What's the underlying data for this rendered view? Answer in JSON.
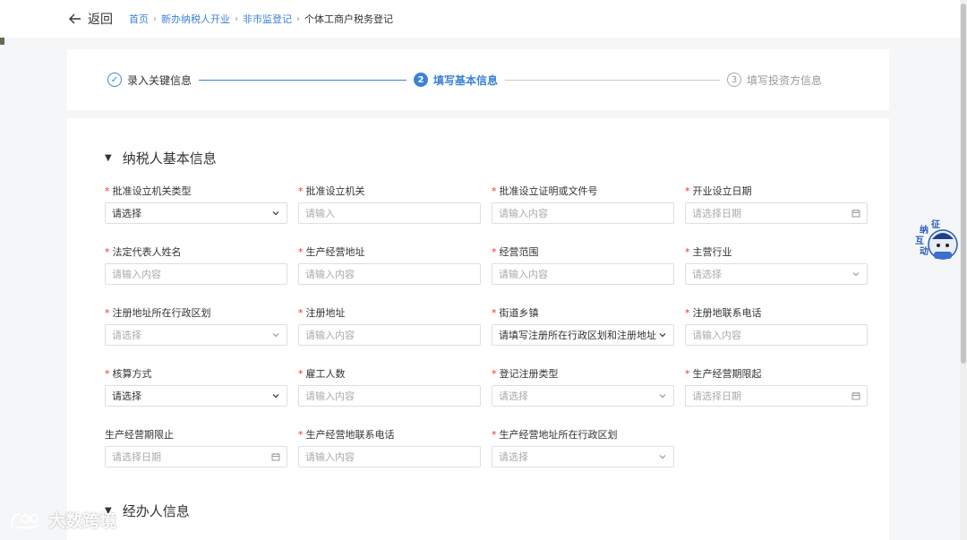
{
  "header": {
    "back_label": "返回",
    "breadcrumbs": [
      "首页",
      "新办纳税人开业",
      "非市监登记"
    ],
    "current": "个体工商户税务登记"
  },
  "steps": [
    {
      "num": "✓",
      "label": "录入关键信息"
    },
    {
      "num": "2",
      "label": "填写基本信息"
    },
    {
      "num": "3",
      "label": "填写投资方信息"
    }
  ],
  "section1": {
    "title": "纳税人基本信息",
    "fields": [
      {
        "label": "批准设立机关类型",
        "value": "请选择",
        "placeholder": ""
      },
      {
        "label": "批准设立机关",
        "value": "",
        "placeholder": "请输入"
      },
      {
        "label": "批准设立证明或文件号",
        "value": "",
        "placeholder": "请输入内容"
      },
      {
        "label": "开业设立日期",
        "value": "",
        "placeholder": "请选择日期"
      },
      {
        "label": "法定代表人姓名",
        "value": "",
        "placeholder": "请输入内容"
      },
      {
        "label": "生产经营地址",
        "value": "",
        "placeholder": "请输入内容"
      },
      {
        "label": "经营范围",
        "value": "",
        "placeholder": "请输入内容"
      },
      {
        "label": "主营行业",
        "value": "",
        "placeholder": "请选择"
      },
      {
        "label": "注册地址所在行政区划",
        "value": "",
        "placeholder": "请选择"
      },
      {
        "label": "注册地址",
        "value": "",
        "placeholder": "请输入内容"
      },
      {
        "label": "街道乡镇",
        "value": "请填写注册所在行政区划和注册地址",
        "placeholder": ""
      },
      {
        "label": "注册地联系电话",
        "value": "",
        "placeholder": "请输入内容"
      },
      {
        "label": "核算方式",
        "value": "请选择",
        "placeholder": ""
      },
      {
        "label": "雇工人数",
        "value": "",
        "placeholder": "请输入内容"
      },
      {
        "label": "登记注册类型",
        "value": "",
        "placeholder": "请选择"
      },
      {
        "label": "生产经营期限起",
        "value": "",
        "placeholder": "请选择日期"
      },
      {
        "label": "生产经营期限止",
        "value": "",
        "placeholder": "请选择日期"
      },
      {
        "label": "生产经营地联系电话",
        "value": "",
        "placeholder": "请输入内容"
      },
      {
        "label": "生产经营地址所在行政区划",
        "value": "",
        "placeholder": "请选择"
      }
    ]
  },
  "section2": {
    "title": "经办人信息"
  },
  "mascot": {
    "chars": [
      "征",
      "纳",
      "互",
      "动"
    ]
  },
  "watermark": {
    "text": "大数跨境"
  },
  "colors": {
    "accent": "#3b82d8",
    "required": "#e33333",
    "placeholder": "#aaaaaa"
  }
}
